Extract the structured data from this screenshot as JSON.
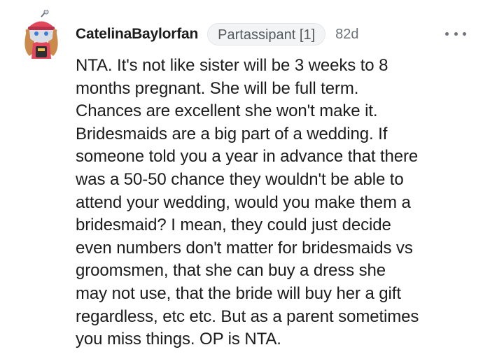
{
  "comment": {
    "author": "CatelinaBaylorfan",
    "flair": "Partassipant [1]",
    "age": "82d",
    "avatar_icon": "snoo-avatar-icon",
    "more_icon": "more-options-icon",
    "body_lines": [
      "NTA. It's not like sister will be 3 weeks to 8",
      "months pregnant. She will be full term.",
      "Chances are excellent she won't make it.",
      "Bridesmaids are a big part of a wedding. If",
      "someone told you a year in advance that there",
      "was a 50-50 chance they wouldn't be able to",
      "attend your wedding, would you make them a",
      "bridesmaid? I mean, they could just decide",
      "even numbers don't matter for bridesmaids vs",
      "groomsmen, that she can buy a dress she",
      "may not use, that the bride will buy her a gift",
      "regardless, etc etc. But as a parent sometimes",
      "you miss things. OP is NTA."
    ]
  },
  "colors": {
    "text": "#1c1c1c",
    "meta": "#6e7379",
    "flair_bg": "#f2f4f5",
    "avatar_head": "#d8dde6",
    "avatar_hair": "#c98a4b",
    "avatar_hat": "#e2475b"
  }
}
